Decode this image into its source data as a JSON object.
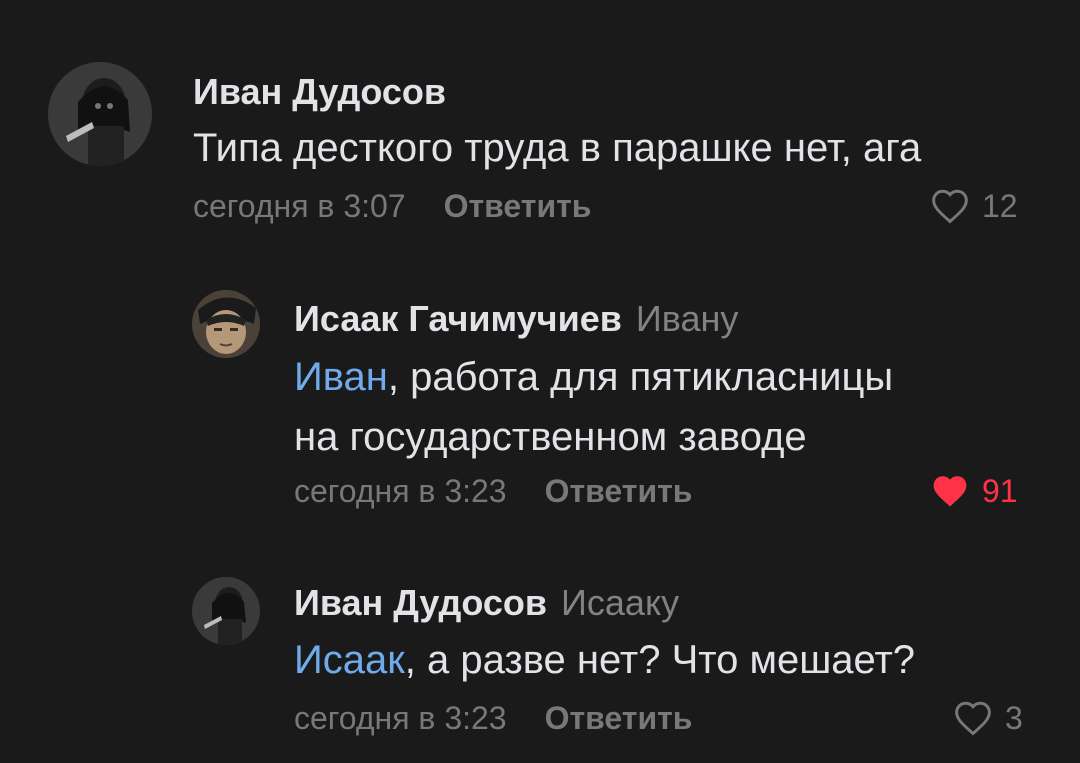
{
  "colors": {
    "background": "#1a1a1a",
    "text_primary": "#e1e3e6",
    "text_secondary": "#76787a",
    "mention": "#71aaeb",
    "like_active": "#ff3347"
  },
  "comments": [
    {
      "author": "Иван Дудосов",
      "reply_to": "",
      "mention": "",
      "text_lines": [
        "Типа десткого труда в парашке нет, ага"
      ],
      "time": "сегодня в 3:07",
      "reply_label": "Ответить",
      "likes": "12",
      "liked": false,
      "like_icon": "heart-outline-icon"
    },
    {
      "author": "Исаак Гачимучиев",
      "reply_to": "Ивану",
      "mention": "Иван",
      "text_lines": [
        ", работа для пятикласницы",
        "на государственном заводе"
      ],
      "time": "сегодня в 3:23",
      "reply_label": "Ответить",
      "likes": "91",
      "liked": true,
      "like_icon": "heart-filled-icon"
    },
    {
      "author": "Иван Дудосов",
      "reply_to": "Исааку",
      "mention": "Исаак",
      "text_lines": [
        ", а разве нет? Что мешает?"
      ],
      "time": "сегодня в 3:23",
      "reply_label": "Ответить",
      "likes": "3",
      "liked": false,
      "like_icon": "heart-outline-icon"
    }
  ]
}
